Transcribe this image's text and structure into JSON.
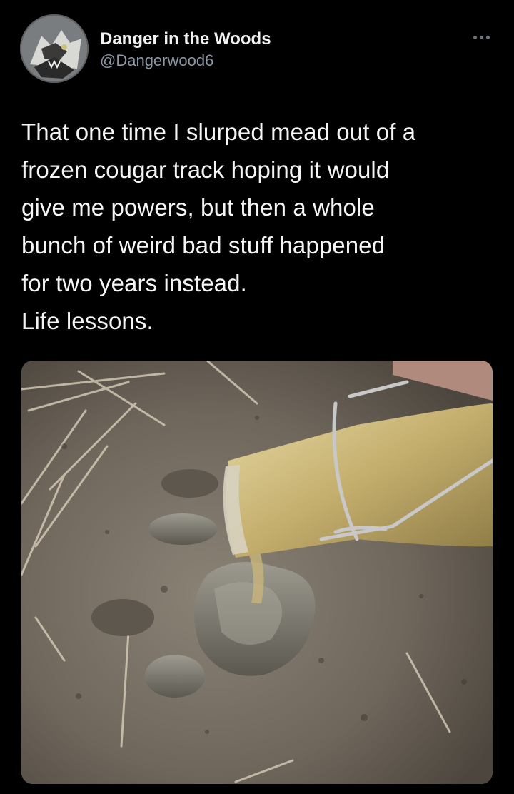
{
  "tweet": {
    "author": {
      "display_name": "Danger in the Woods",
      "handle": "@Dangerwood6",
      "avatar_icon": "wolf-head-avatar-icon"
    },
    "more_icon": "more-options-icon",
    "text": "That one time I slurped mead out of a\nfrozen cougar track hoping it would\ngive me powers, but then a whole\nbunch of weird bad stuff happened\nfor two years instead.\nLife lessons.",
    "media": {
      "description_icon": "photo-mead-poured-into-cougar-track"
    }
  },
  "colors": {
    "background": "#000000",
    "text": "#f5f5f5",
    "handle": "#8b98a5",
    "mead": "#c9b57a",
    "dirt": "#7d756a"
  }
}
